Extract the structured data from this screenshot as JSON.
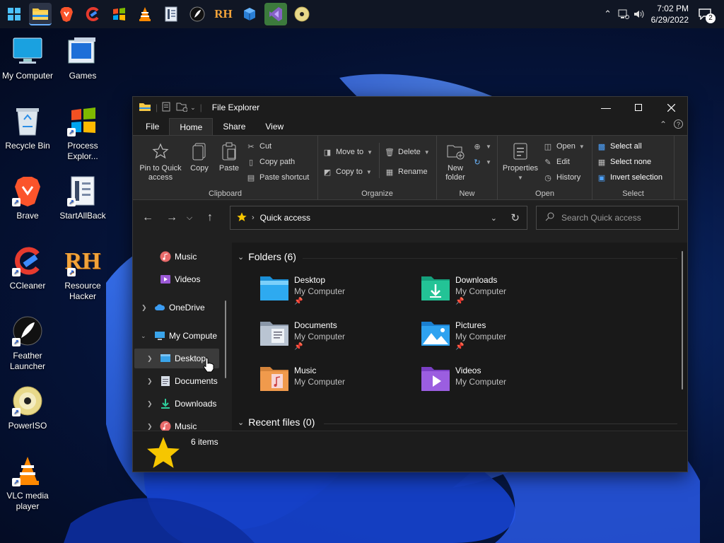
{
  "taskbar": {
    "apps": [
      {
        "name": "start",
        "icon": "windows-logo-icon"
      },
      {
        "name": "file-explorer",
        "icon": "folder-icon",
        "active": true
      },
      {
        "name": "brave",
        "icon": "brave-lion-icon"
      },
      {
        "name": "ccleaner",
        "icon": "ccleaner-icon"
      },
      {
        "name": "process-explorer",
        "icon": "process-explorer-icon"
      },
      {
        "name": "vlc",
        "icon": "vlc-cone-icon"
      },
      {
        "name": "startallback",
        "icon": "startallback-icon"
      },
      {
        "name": "feather-launcher",
        "icon": "feather-icon"
      },
      {
        "name": "resource-hacker",
        "label": "RH"
      },
      {
        "name": "cube-app",
        "icon": "cube-icon"
      },
      {
        "name": "visual-studio",
        "icon": "visual-studio-icon"
      },
      {
        "name": "poweriso",
        "icon": "disc-icon"
      }
    ],
    "tray": {
      "time": "7:02 PM",
      "date": "6/29/2022",
      "notification_count": "2"
    }
  },
  "desktop": {
    "icons": [
      {
        "label": "My Computer",
        "icon": "monitor-icon"
      },
      {
        "label": "Games",
        "icon": "games-icon"
      },
      {
        "label": "Recycle Bin",
        "icon": "recycle-bin-icon"
      },
      {
        "label": "Process Explor...",
        "icon": "process-explorer-icon"
      },
      {
        "label": "Brave",
        "icon": "brave-lion-icon"
      },
      {
        "label": "StartAllBack",
        "icon": "startallback-icon"
      },
      {
        "label": "CCleaner",
        "icon": "ccleaner-icon"
      },
      {
        "label": "Resource Hacker",
        "icon": "rh-icon",
        "glyph": "RH"
      },
      {
        "label": "Feather Launcher",
        "icon": "feather-icon"
      },
      {
        "label": "PowerISO",
        "icon": "disc-icon"
      },
      {
        "label": "VLC media player",
        "icon": "vlc-cone-icon"
      }
    ]
  },
  "explorer": {
    "title": "File Explorer",
    "tabs": [
      "File",
      "Home",
      "Share",
      "View"
    ],
    "active_tab": "Home",
    "ribbon": {
      "clipboard": {
        "label": "Clipboard",
        "pin": "Pin to Quick access",
        "copy": "Copy",
        "paste": "Paste",
        "cut": "Cut",
        "copy_path": "Copy path",
        "paste_shortcut": "Paste shortcut"
      },
      "organize": {
        "label": "Organize",
        "move_to": "Move to",
        "copy_to": "Copy to",
        "delete": "Delete",
        "rename": "Rename"
      },
      "new": {
        "label": "New",
        "new_folder": "New folder"
      },
      "open": {
        "label": "Open",
        "properties": "Properties",
        "open": "Open",
        "edit": "Edit",
        "history": "History"
      },
      "select": {
        "label": "Select",
        "select_all": "Select all",
        "select_none": "Select none",
        "invert_selection": "Invert selection"
      }
    },
    "address": "Quick access",
    "search_placeholder": "Search Quick access",
    "nav_items": [
      {
        "label": "Music",
        "icon": "music-icon",
        "level": 1,
        "chevron": false
      },
      {
        "label": "Videos",
        "icon": "video-icon",
        "level": 1,
        "chevron": false
      },
      {
        "label": "OneDrive",
        "icon": "cloud-icon",
        "level": 0,
        "chevron": "right"
      },
      {
        "label": "My Compute",
        "icon": "monitor-icon",
        "level": 0,
        "chevron": "down"
      },
      {
        "label": "Desktop",
        "icon": "desktop-icon",
        "level": 1,
        "chevron": "right",
        "selected": true
      },
      {
        "label": "Documents",
        "icon": "documents-icon",
        "level": 1,
        "chevron": "right"
      },
      {
        "label": "Downloads",
        "icon": "download-icon",
        "level": 1,
        "chevron": "right"
      },
      {
        "label": "Music",
        "icon": "music-icon",
        "level": 1,
        "chevron": "right"
      }
    ],
    "folders_header": "Folders (6)",
    "folders": [
      {
        "name": "Desktop",
        "location": "My Computer",
        "pinned": true,
        "icon": "desktop-folder-icon"
      },
      {
        "name": "Downloads",
        "location": "My Computer",
        "pinned": true,
        "icon": "downloads-folder-icon"
      },
      {
        "name": "Documents",
        "location": "My Computer",
        "pinned": true,
        "icon": "documents-folder-icon"
      },
      {
        "name": "Pictures",
        "location": "My Computer",
        "pinned": true,
        "icon": "pictures-folder-icon"
      },
      {
        "name": "Music",
        "location": "My Computer",
        "pinned": false,
        "icon": "music-folder-icon"
      },
      {
        "name": "Videos",
        "location": "My Computer",
        "pinned": false,
        "icon": "videos-folder-icon"
      }
    ],
    "recent_header": "Recent files (0)",
    "status": {
      "item_count": "6 items",
      "icon": "star-icon"
    }
  },
  "colors": {
    "window_bg": "#202020",
    "ribbon_bg": "#2b2b2b",
    "accent": "#0078d4",
    "star": "#f6c600"
  }
}
